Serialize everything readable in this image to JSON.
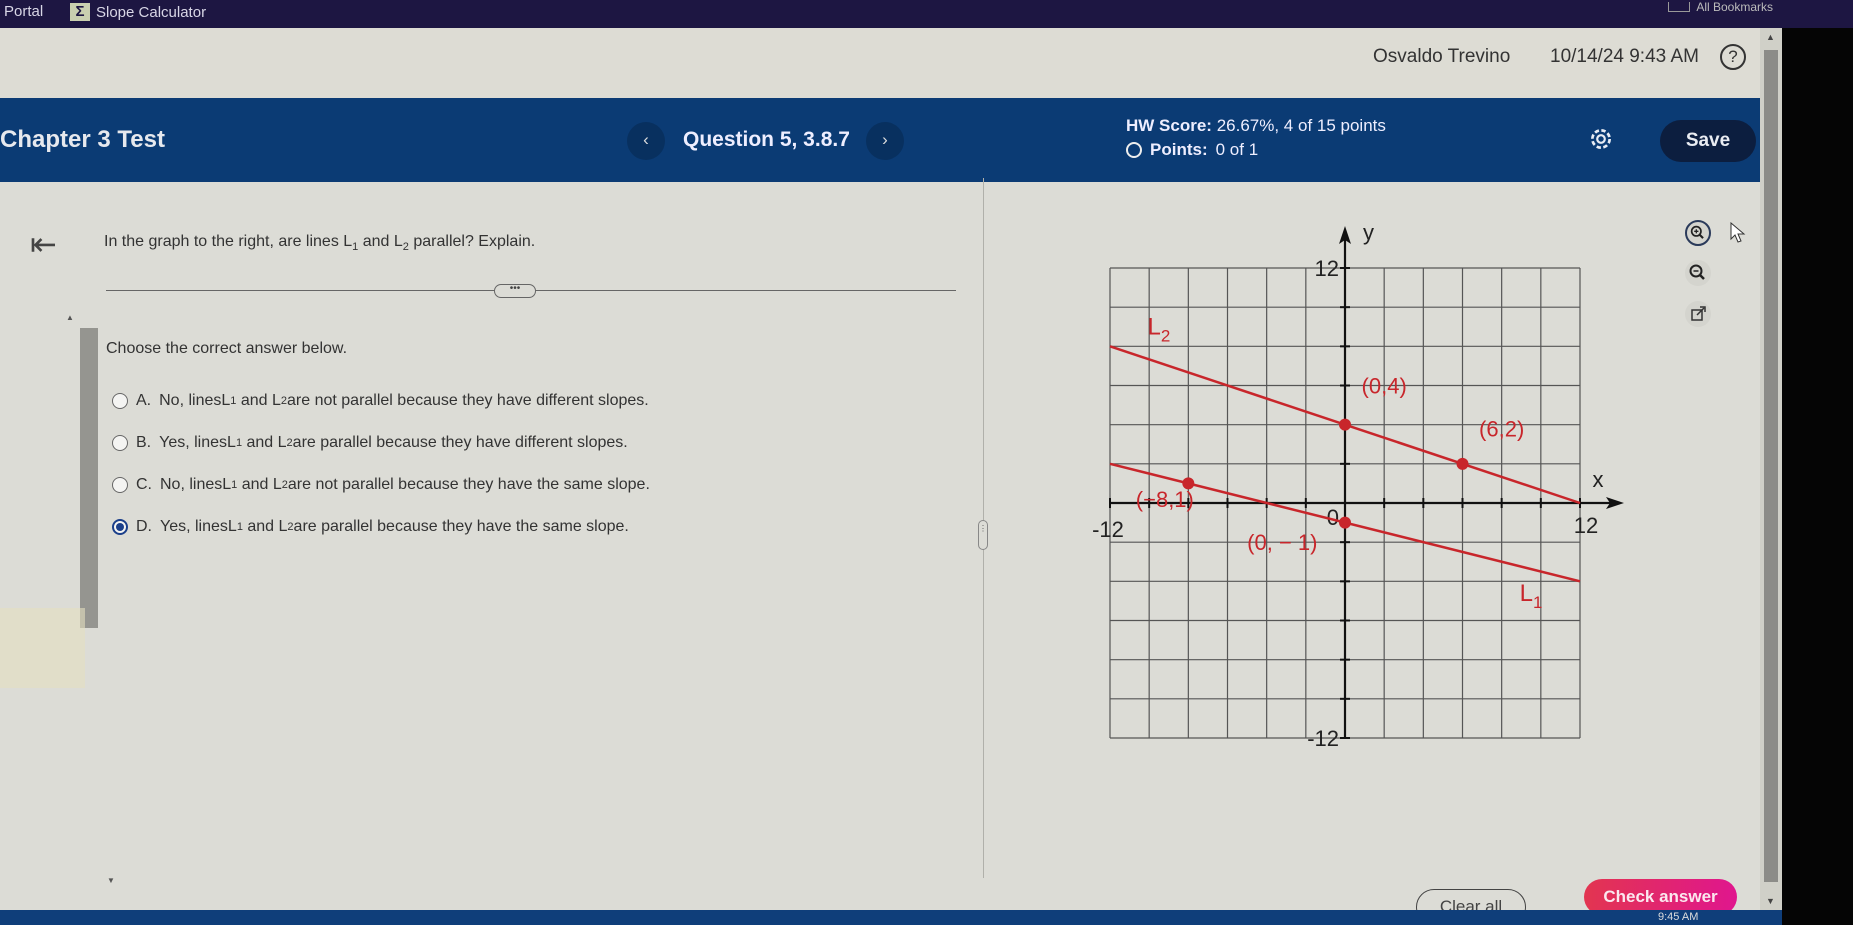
{
  "browser": {
    "bookmarks": [
      {
        "label": "Portal"
      },
      {
        "label": "Slope Calculator",
        "icon": "sigma-icon"
      }
    ],
    "all_bookmarks_label": "All Bookmarks"
  },
  "userbar": {
    "user_name": "Osvaldo Trevino",
    "datetime": "10/14/24 9:43 AM",
    "help_glyph": "?"
  },
  "header": {
    "title": "Chapter 3 Test",
    "prev_glyph": "‹",
    "next_glyph": "›",
    "question_label": "Question 5, 3.8.7",
    "hw_score_label": "HW Score:",
    "hw_score_value": "26.67%, 4 of 15 points",
    "points_label": "Points:",
    "points_value": "0 of 1",
    "save_label": "Save"
  },
  "question": {
    "prefix": "In the graph to the right, are lines ",
    "line1": "L",
    "line1_sub": "1",
    "and": " and ",
    "line2": "L",
    "line2_sub": "2",
    "suffix": " parallel? Explain.",
    "more_glyph": "•••",
    "prompt": "Choose the correct answer below."
  },
  "options": [
    {
      "letter": "A.",
      "pre": "No, lines ",
      "post": " are not parallel because they have different slopes.",
      "selected": false
    },
    {
      "letter": "B.",
      "pre": "Yes, lines ",
      "post": " are parallel because they have different slopes.",
      "selected": false
    },
    {
      "letter": "C.",
      "pre": "No, lines ",
      "post": " are not parallel because they have the same slope.",
      "selected": false
    },
    {
      "letter": "D.",
      "pre": "Yes, lines ",
      "post": " are parallel because they have the same slope.",
      "selected": true
    }
  ],
  "graph": {
    "x_axis_label": "x",
    "y_axis_label": "y",
    "xlim": [
      -12,
      12
    ],
    "ylim": [
      -12,
      12
    ],
    "grid_step": 2,
    "tick_labels": {
      "x_min": "-12",
      "x_max": "12",
      "y_min": "-12",
      "y_max": "12",
      "origin": "0"
    },
    "line_color": "#c8262b",
    "lines": [
      {
        "name": "L2",
        "label": "L",
        "sub": "2",
        "points": [
          [
            0,
            4
          ],
          [
            6,
            2
          ]
        ],
        "point_labels": [
          "(0,4)",
          "(6,2)"
        ],
        "domain": [
          -12,
          12
        ]
      },
      {
        "name": "L1",
        "label": "L",
        "sub": "1",
        "points": [
          [
            -8,
            1
          ],
          [
            0,
            -1
          ]
        ],
        "point_labels": [
          "(−8,1)",
          "(0, − 1)"
        ],
        "domain": [
          -12,
          12
        ]
      }
    ]
  },
  "tools": {
    "zoom_in": "zoom-in",
    "zoom_out": "zoom-out",
    "popout": "open-in-new-window"
  },
  "footer": {
    "clear_label": "Clear all",
    "check_label": "Check answer"
  },
  "taskbar": {
    "time": "9:45 AM"
  },
  "colors": {
    "header_bg": "#0b3b74",
    "check_button": "#e0168e",
    "selected_radio": "#1b3f8a",
    "graph_line": "#c8262b"
  }
}
